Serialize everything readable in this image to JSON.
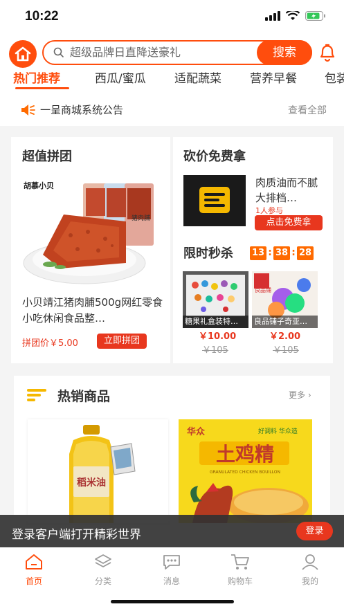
{
  "status_bar": {
    "time": "10:22"
  },
  "search": {
    "placeholder": "超级品牌日直降送豪礼",
    "button": "搜索"
  },
  "tabs": [
    {
      "label": "热门推荐"
    },
    {
      "label": "西瓜/蜜瓜"
    },
    {
      "label": "适配蔬菜"
    },
    {
      "label": "营养早餐"
    },
    {
      "label": "包装"
    }
  ],
  "notice": {
    "text": "一呈商城系统公告",
    "view_all": "查看全部"
  },
  "group_buy": {
    "title": "超值拼团",
    "product_name": "小贝靖江猪肉脯500g网红零食小吃休闲食品整…",
    "price_label": "拼团价￥5.00",
    "button": "立即拼团",
    "pkg_brand": "胡慕小贝",
    "pkg_label": "猪肉脯"
  },
  "bargain": {
    "title": "砍价免费拿",
    "product_name": "肉质油而不腻大排档…",
    "participants": "1人参与",
    "button": "点击免费拿"
  },
  "flash_sale": {
    "title": "限时秒杀",
    "countdown": {
      "h": "13",
      "m": "38",
      "s": "28"
    },
    "items": [
      {
        "name": "糖果礼盒装特…",
        "price": "￥10.00",
        "orig": "￥105"
      },
      {
        "name": "良品铺子奇亚…",
        "price": "￥2.00",
        "orig": "￥105"
      }
    ],
    "item2_brand": "良品铺"
  },
  "hot": {
    "title": "热销商品",
    "more": "更多",
    "items": [
      {
        "label": "稻米油"
      },
      {
        "brand": "华众",
        "name": "土鸡精",
        "en": "GRANULATED CHICKEN BOUILLON",
        "tag": "好调料 华众造"
      }
    ]
  },
  "login_bar": {
    "text": "登录客户端打开精彩世界",
    "button": "登录"
  },
  "tabbar": [
    {
      "label": "首页",
      "icon": "home-icon"
    },
    {
      "label": "分类",
      "icon": "layers-icon"
    },
    {
      "label": "消息",
      "icon": "chat-icon"
    },
    {
      "label": "购物车",
      "icon": "cart-icon"
    },
    {
      "label": "我的",
      "icon": "user-icon"
    }
  ],
  "colors": {
    "accent": "#ff4d0d",
    "price_red": "#e8371e",
    "countdown": "#ff6a00"
  }
}
